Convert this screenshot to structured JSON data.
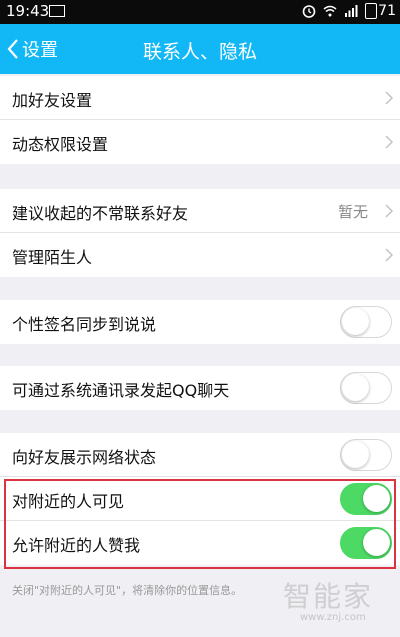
{
  "status_bar": {
    "time": "19:43",
    "battery": "71"
  },
  "header": {
    "back_label": "设置",
    "title": "联系人、隐私"
  },
  "groups": [
    [
      {
        "label": "加好友设置",
        "control": "chevron"
      },
      {
        "label": "动态权限设置",
        "control": "chevron"
      }
    ],
    [
      {
        "label": "建议收起的不常联系好友",
        "value": "暂无",
        "control": "chevron"
      },
      {
        "label": "管理陌生人",
        "control": "chevron"
      }
    ],
    [
      {
        "label": "个性签名同步到说说",
        "control": "toggle",
        "on": false
      }
    ],
    [
      {
        "label": "可通过系统通讯录发起QQ聊天",
        "control": "toggle",
        "on": false
      }
    ],
    [
      {
        "label": "向好友展示网络状态",
        "control": "toggle",
        "on": false
      },
      {
        "label": "对附近的人可见",
        "control": "toggle",
        "on": true
      },
      {
        "label": "允许附近的人赞我",
        "control": "toggle",
        "on": true
      }
    ]
  ],
  "footer_note": "关闭\"对附近的人可见\"，将清除你的位置信息。",
  "watermark": {
    "text": "智能家",
    "url": "www.znj.com"
  },
  "colors": {
    "header": "#12b7f5",
    "toggle_on": "#4cd964",
    "highlight": "#d9343f"
  }
}
